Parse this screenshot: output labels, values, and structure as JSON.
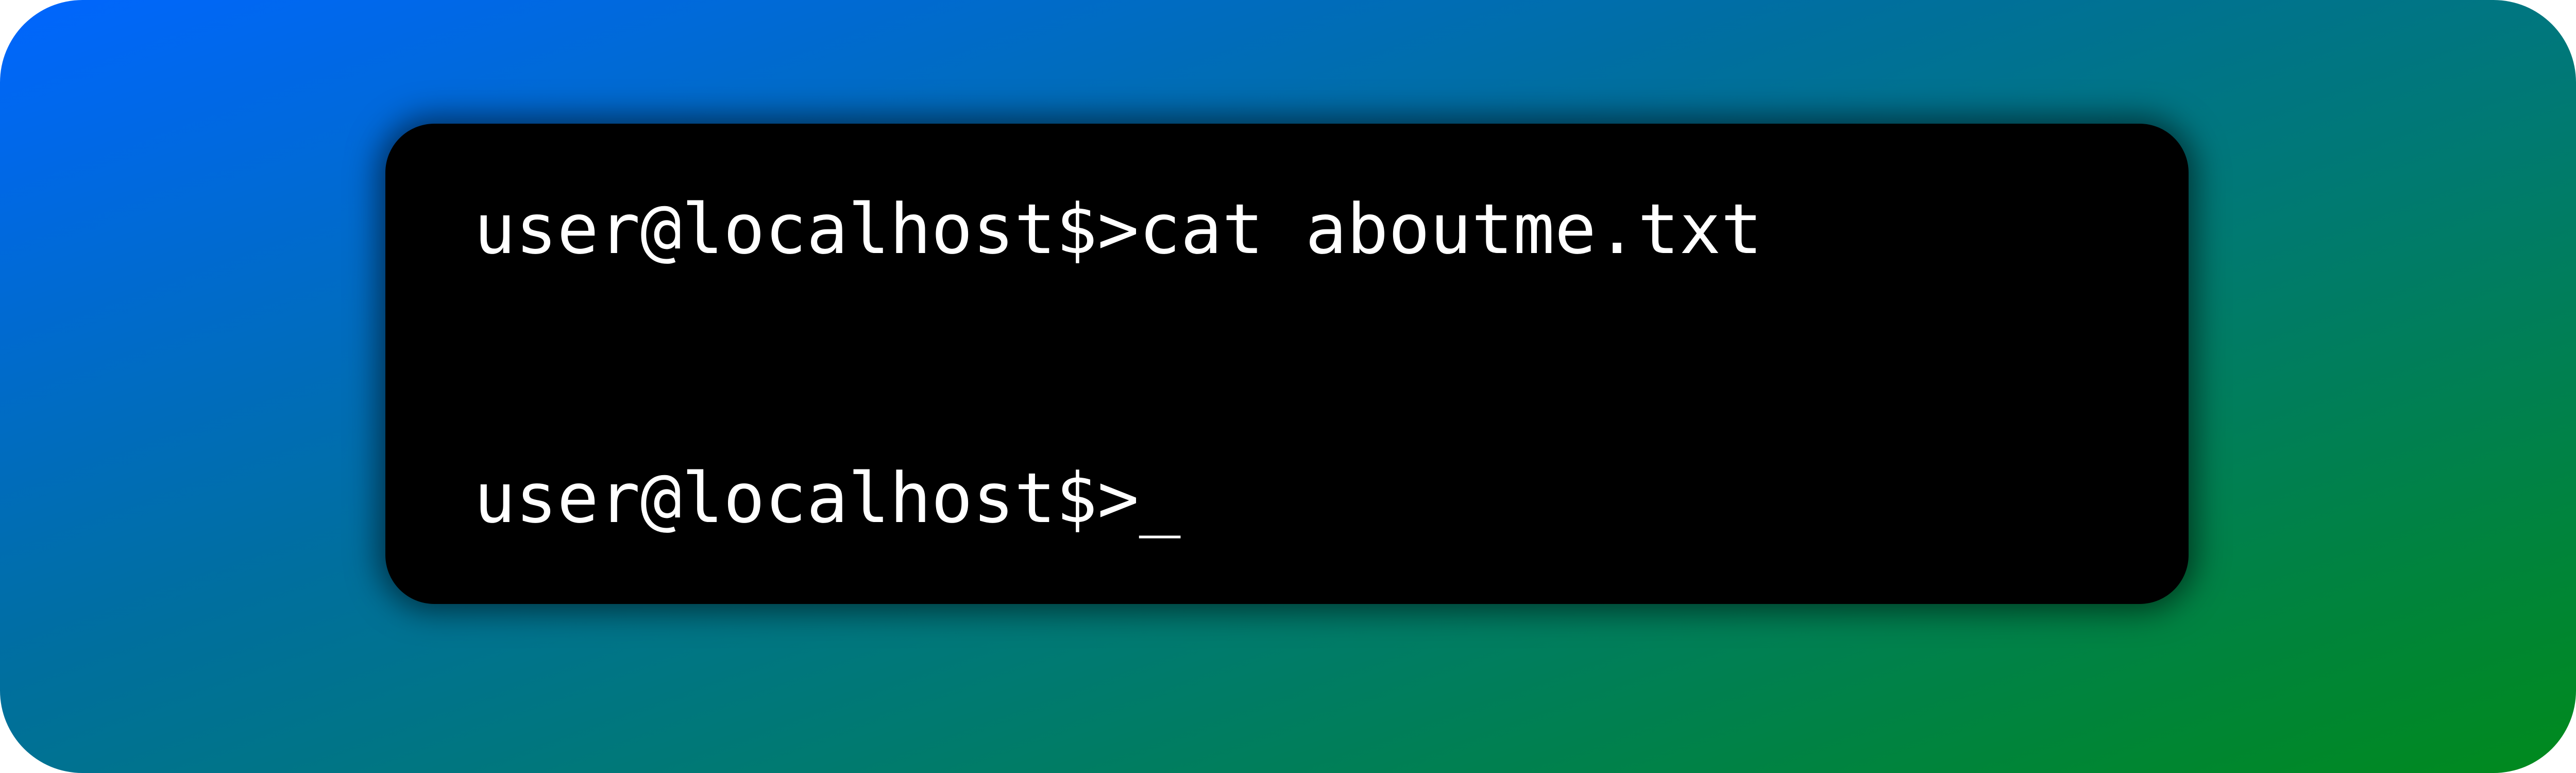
{
  "terminal": {
    "lines": [
      {
        "prompt": "user@localhost$>",
        "command": "cat aboutme.txt"
      },
      {
        "prompt": "user@localhost$>",
        "cursor": "_"
      }
    ]
  },
  "colors": {
    "gradient_start": "#0066ff",
    "gradient_end": "#008a1c",
    "terminal_background": "#000000",
    "terminal_text": "#ffffff"
  }
}
